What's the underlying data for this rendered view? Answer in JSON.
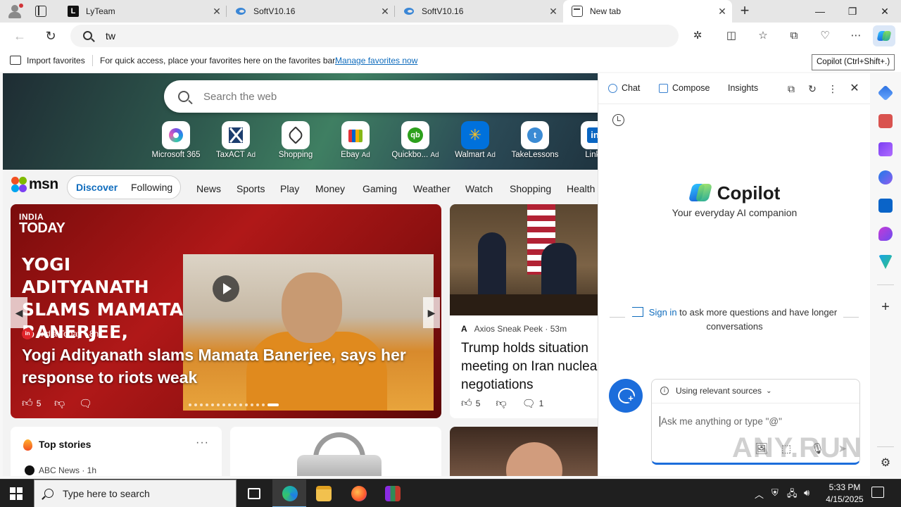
{
  "tabs": [
    {
      "title": "LyTeam",
      "icon": "lyteam-icon"
    },
    {
      "title": "SoftV10.16",
      "icon": "softv-icon"
    },
    {
      "title": "SoftV10.16",
      "icon": "softv-icon"
    },
    {
      "title": "New tab",
      "icon": "newtab-icon"
    }
  ],
  "window": {
    "minimize": "—",
    "restore": "❐",
    "close": "✕"
  },
  "address": {
    "value": "tw"
  },
  "favorites_bar": {
    "import_label": "Import favorites",
    "message": "For quick access, place your favorites here on the favorites bar.",
    "manage_link": "Manage favorites now"
  },
  "tooltip": "Copilot (Ctrl+Shift+.)",
  "ntp": {
    "search_placeholder": "Search the web",
    "quick_links": [
      {
        "label": "Microsoft 365",
        "ad": ""
      },
      {
        "label": "TaxACT",
        "ad": "Ad"
      },
      {
        "label": "Shopping",
        "ad": ""
      },
      {
        "label": "Ebay",
        "ad": "Ad"
      },
      {
        "label": "Quickbo...",
        "ad": "Ad"
      },
      {
        "label": "Walmart",
        "ad": "Ad"
      },
      {
        "label": "TakeLessons",
        "ad": ""
      },
      {
        "label": "Linke",
        "ad": ""
      }
    ],
    "msn": {
      "logo": "msn",
      "discover": "Discover",
      "following": "Following",
      "categories": [
        "News",
        "Sports",
        "Play",
        "Money",
        "Gaming",
        "Weather",
        "Watch",
        "Shopping",
        "Health"
      ]
    },
    "main_card": {
      "logo_line1": "INDIA",
      "logo_line2": "TODAY",
      "overlay_text": "YOGI ADITYANATH SLAMS MAMATA BANERJEE,",
      "source": "India Today · 8h",
      "source_badge": "in",
      "title": "Yogi Adityanath slams Mamata Banerjee, says her response to riots weak",
      "likes": "5"
    },
    "side_card": {
      "source_logo": "A",
      "source": "Axios Sneak Peek · 53m",
      "title": "Trump holds situation meeting on Iran nuclear negotiations",
      "likes": "5",
      "comments": "1"
    },
    "top_stories": {
      "title": "Top stories",
      "more": "···",
      "first_source": "ABC News · 1h"
    }
  },
  "copilot": {
    "tabs": [
      "Chat",
      "Compose",
      "Insights"
    ],
    "brand_name": "Copilot",
    "tagline": "Your everyday AI companion",
    "signin_link": "Sign in",
    "signin_text": "to ask more questions and have longer conversations",
    "sources_label": "Using relevant sources",
    "input_placeholder": "Ask me anything or type \"@\""
  },
  "taskbar": {
    "search_placeholder": "Type here to search",
    "time": "5:33 PM",
    "date": "4/15/2025"
  },
  "watermark": "ANY.RUN",
  "colors": {
    "accent": "#0f6cbd",
    "copilot_blue": "#1c6ddb",
    "taskbar": "#1f1f1f"
  }
}
